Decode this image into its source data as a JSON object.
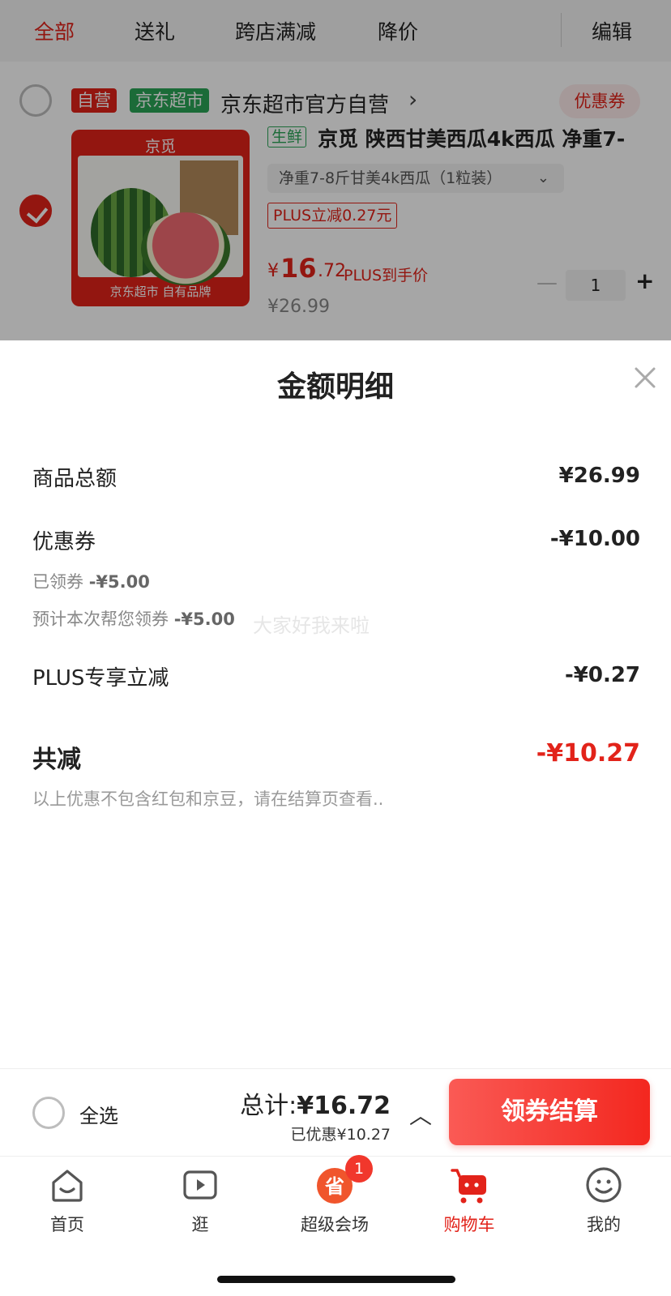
{
  "tabs": [
    {
      "label": "全部",
      "active": true
    },
    {
      "label": "送礼",
      "active": false
    },
    {
      "label": "跨店满减",
      "active": false
    },
    {
      "label": "降价",
      "active": false
    }
  ],
  "edit_label": "编辑",
  "store": {
    "badge_self": "自营",
    "badge_supermarket": "京东超市",
    "name": "京东超市官方自营",
    "coupon_button": "优惠券"
  },
  "product": {
    "image_brand": "京觅",
    "image_bottom": "京东超市 自有品牌",
    "fresh_tag": "生鲜",
    "title": "京觅 陕西甘美西瓜4k西瓜 净重7-",
    "spec": "净重7-8斤甘美4k西瓜（1粒装）",
    "plus_tag": "PLUS立减0.27元",
    "price_currency": "¥",
    "price_int": "16",
    "price_dec": ".72",
    "price_note": "PLUS到手价",
    "original_price": "¥26.99",
    "quantity": "1",
    "checked": true
  },
  "sheet": {
    "title": "金额明细",
    "rows": [
      {
        "label": "商品总额",
        "value": "¥26.99"
      },
      {
        "label": "优惠券",
        "value": "-¥10.00"
      },
      {
        "label": "PLUS专享立减",
        "value": "-¥0.27"
      }
    ],
    "coupon_sub": [
      {
        "label": "已领券",
        "value": "-¥5.00"
      },
      {
        "label": "预计本次帮您领券",
        "value": "-¥5.00"
      }
    ],
    "total_label": "共减",
    "total_value": "-¥10.27",
    "note": "以上优惠不包含红包和京豆，请在结算页查看..",
    "watermark": "大家好我来啦"
  },
  "summary": {
    "select_all": "全选",
    "total_prefix": "总计:",
    "total_amount": "¥16.72",
    "saved": "已优惠¥10.27",
    "checkout": "领券结算"
  },
  "tabbar": [
    {
      "label": "首页",
      "icon": "home-icon",
      "active": false
    },
    {
      "label": "逛",
      "icon": "video-play-icon",
      "active": false
    },
    {
      "label": "超级会场",
      "icon": "super-venue-icon",
      "active": false,
      "badge": "1"
    },
    {
      "label": "购物车",
      "icon": "cart-icon",
      "active": true
    },
    {
      "label": "我的",
      "icon": "profile-icon",
      "active": false
    }
  ],
  "colors": {
    "accent": "#e2231a",
    "supermarket_green": "#2aa557"
  }
}
